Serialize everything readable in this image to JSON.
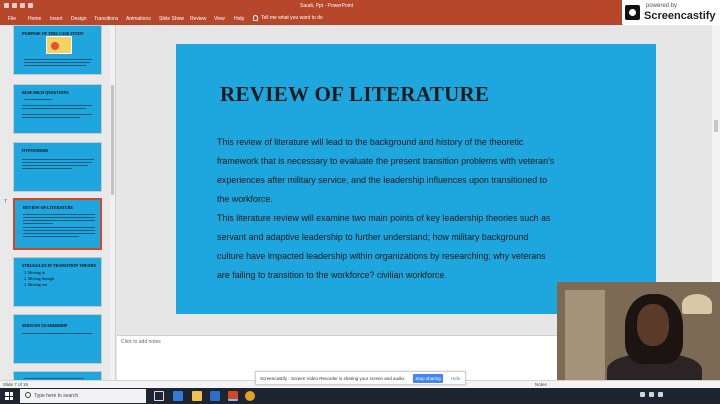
{
  "window": {
    "title": "Saudi, Ppt  -  PowerPoint"
  },
  "ribbon": {
    "tabs": [
      "File",
      "Home",
      "Insert",
      "Design",
      "Transitions",
      "Animations",
      "Slide Show",
      "Review",
      "View",
      "Help"
    ],
    "tell_me": "Tell me what you want to do"
  },
  "watermark": {
    "powered_by": "powered by",
    "brand": "Screencastify"
  },
  "thumbnails": [
    {
      "number": "",
      "title": "PURPOSE OF THIS CASE STUDY",
      "kind": "image",
      "active": false
    },
    {
      "number": "",
      "title": "RESEARCH QUESTIONS",
      "kind": "text",
      "active": false
    },
    {
      "number": "",
      "title": "HYPOTHESIS",
      "kind": "text",
      "active": false
    },
    {
      "number": "7",
      "title": "REVIEW OF LITERATURE",
      "kind": "text",
      "active": true
    },
    {
      "number": "",
      "title": "STRUGGLES IN TRANSITION THEORY",
      "kind": "list",
      "active": false,
      "items": [
        "1.  Moving in",
        "2.  Moving through",
        "3.  Moving out"
      ]
    },
    {
      "number": "",
      "title": "SERVANT LEADERSHIP",
      "kind": "text",
      "active": false
    },
    {
      "number": "",
      "title": "",
      "kind": "text",
      "active": false
    }
  ],
  "slide": {
    "title": "REVIEW OF LITERATURE",
    "body_lines": [
      "This review of literature will lead to the background and history of the theoretic",
      " framework that is necessary to evaluate the present transition problems with veteran’s",
      "experiences after military service, and the leadership influences upon transitioned to",
      "the workforce.",
      "This literature review will examine two main points of key leadership theories such as",
      "servant and adaptive leadership to further understand; how military background",
      "culture have impacted leadership within organizations by researching; why veterans",
      "are failing to transition to the workforce?  civilian workforce."
    ]
  },
  "notes": {
    "placeholder": "Click to add notes"
  },
  "status": {
    "slide_info": "Slide 7 of 19",
    "notes_label": "Notes"
  },
  "share_banner": {
    "message": "Screencastify - Screen Video Recorder is sharing your screen and audio.",
    "stop_label": "Stop sharing",
    "hide_label": "Hide"
  },
  "taskbar": {
    "search_placeholder": "Type here to search",
    "time": "",
    "date": ""
  },
  "colors": {
    "accent": "#b7472a",
    "slide_bg": "#1ea6df",
    "active_thumb_border": "#d24726"
  }
}
